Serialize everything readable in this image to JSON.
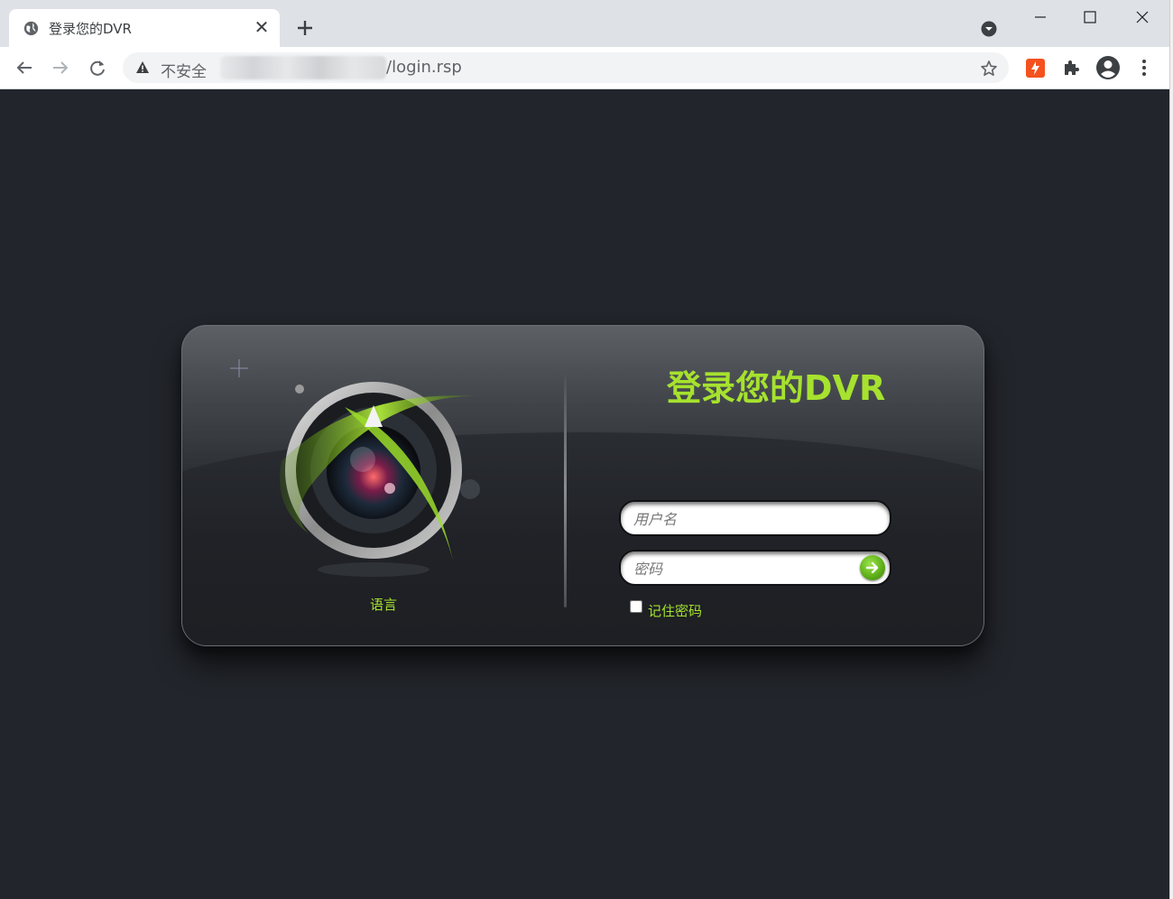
{
  "browser": {
    "tab": {
      "title": "登录您的DVR",
      "close": "✕"
    },
    "address": {
      "security_label": "不安全",
      "url_visible": "/login.rsp"
    }
  },
  "login": {
    "title": "登录您的DVR",
    "username_placeholder": "用户名",
    "password_placeholder": "密码",
    "remember_label": "记住密码",
    "language_link": "语言"
  },
  "icons": {
    "tab_favicon": "globe-icon",
    "new_tab": "plus-icon",
    "tab_search": "chevron-down-circle-icon",
    "back": "arrow-left-icon",
    "forward": "arrow-right-icon",
    "reload": "reload-icon",
    "security": "warning-triangle-icon",
    "bookmark": "star-icon",
    "extension": "puzzle-icon",
    "profile": "account-circle-icon",
    "menu": "kebab-menu-icon",
    "submit": "green-arrow-icon"
  },
  "colors": {
    "accent_green": "#a6e22e",
    "page_background": "#22252b",
    "chrome_tabstrip": "#dee1e6"
  }
}
